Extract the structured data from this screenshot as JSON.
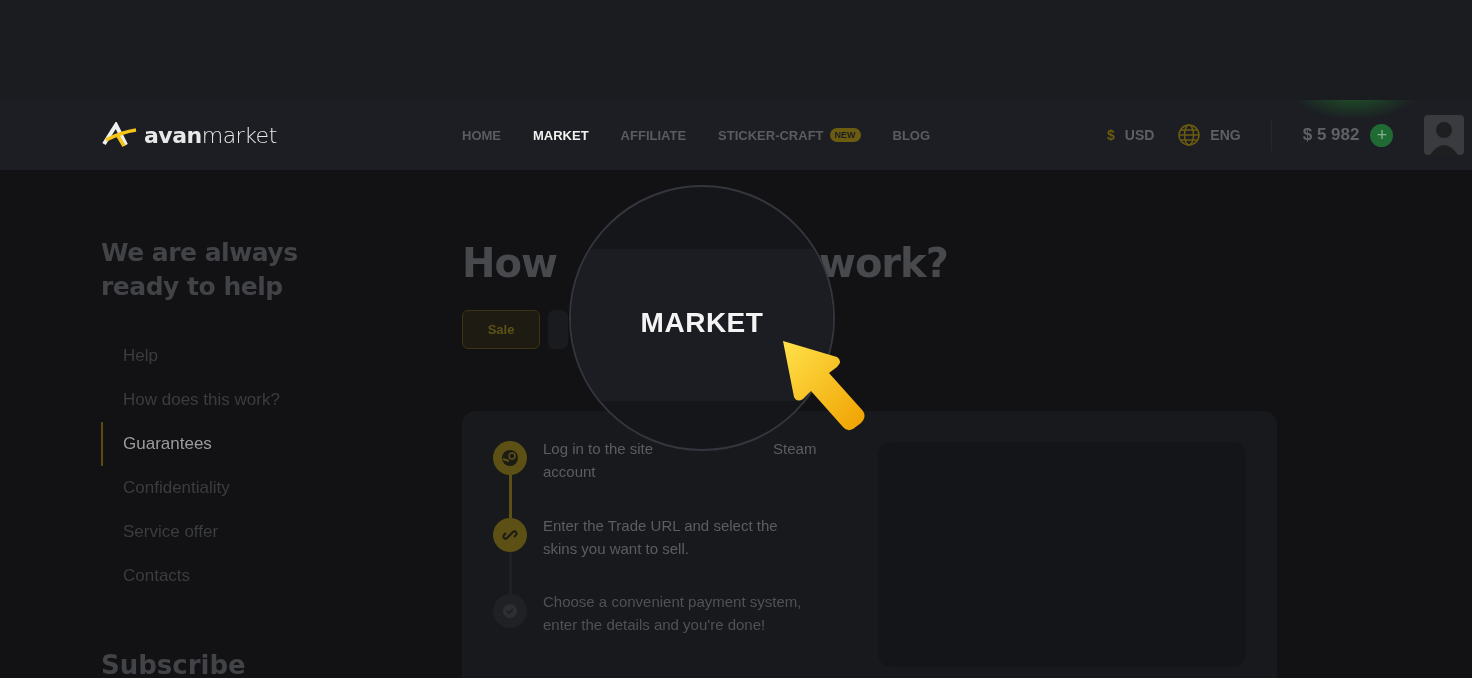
{
  "header": {
    "logo": {
      "bold": "avan",
      "light": "market"
    },
    "nav": [
      {
        "label": "HOME",
        "selected": false
      },
      {
        "label": "MARKET",
        "selected": true
      },
      {
        "label": "AFFILIATE",
        "selected": false
      },
      {
        "label": "STICKER-CRAFT",
        "selected": false,
        "badge": "NEW"
      },
      {
        "label": "BLOG",
        "selected": false
      }
    ],
    "currency": {
      "symbol": "$",
      "label": "USD"
    },
    "language": {
      "label": "ENG"
    },
    "balance": "$ 5 982",
    "add_button": "+"
  },
  "sidebar": {
    "title": "We are always ready to help",
    "items": [
      {
        "label": "Help",
        "selected": false
      },
      {
        "label": "How does this work?",
        "selected": false
      },
      {
        "label": "Guarantees",
        "selected": true
      },
      {
        "label": "Confidentiality",
        "selected": false
      },
      {
        "label": "Service offer",
        "selected": false
      },
      {
        "label": "Contacts",
        "selected": false
      }
    ],
    "subscribe_title": "Subscribe"
  },
  "main": {
    "title_parts": [
      "How",
      "work?"
    ],
    "tabs": [
      {
        "label": "Sale",
        "selected": true
      },
      {
        "selected": false
      }
    ],
    "steps": [
      {
        "kind": "steam",
        "active": true,
        "lines": [
          [
            "Log in to the site",
            "Steam"
          ],
          [
            "account"
          ]
        ]
      },
      {
        "kind": "link",
        "active": true,
        "lines": [
          [
            "Enter the Trade URL and select the"
          ],
          [
            "skins you want to sell."
          ]
        ]
      },
      {
        "kind": "check",
        "active": false,
        "lines": [
          [
            "Choose a convenient payment system,"
          ],
          [
            "enter the details and you're done!"
          ]
        ]
      }
    ]
  },
  "magnifier": {
    "label": "MARKET"
  }
}
